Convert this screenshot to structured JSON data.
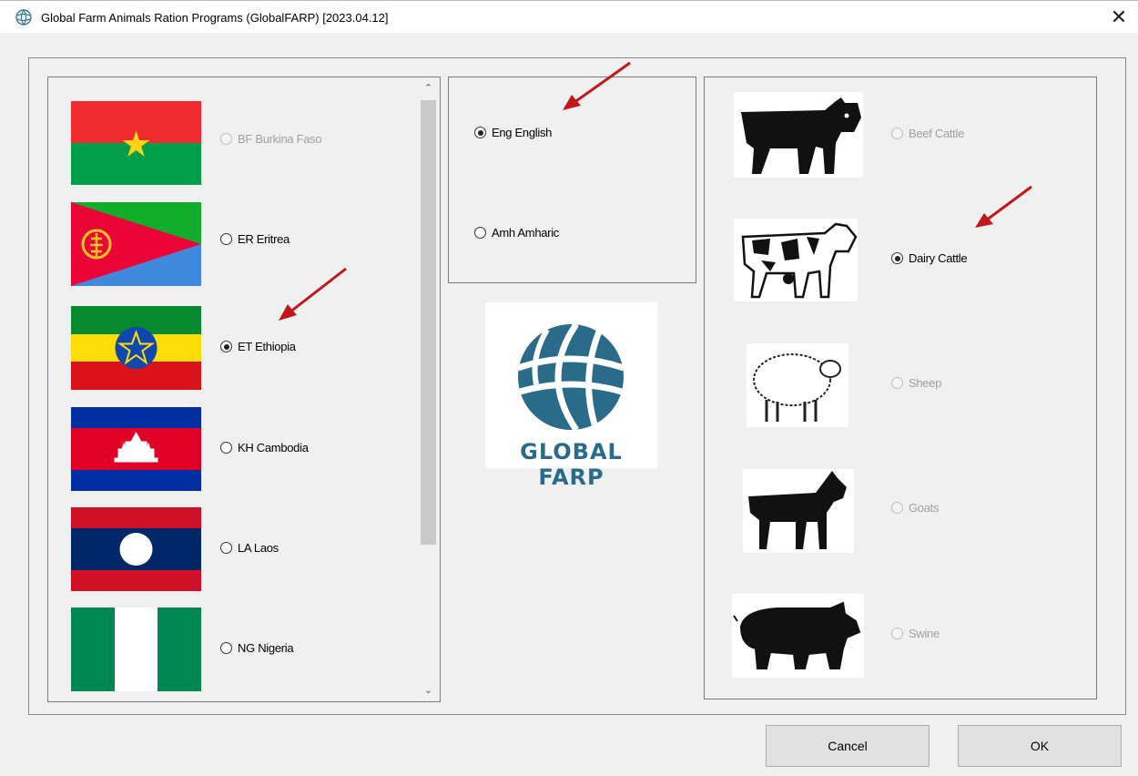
{
  "window": {
    "title": "Global Farm Animals Ration Programs (GlobalFARP) [2023.04.12]",
    "close_glyph": "✕",
    "icon": "globe-icon"
  },
  "countries": [
    {
      "code_label": "BF Burkina Faso",
      "checked": false,
      "disabled": true
    },
    {
      "code_label": "ER Eritrea",
      "checked": false,
      "disabled": false
    },
    {
      "code_label": "ET Ethiopia",
      "checked": true,
      "disabled": false
    },
    {
      "code_label": "KH Cambodia",
      "checked": false,
      "disabled": false
    },
    {
      "code_label": "LA Laos",
      "checked": false,
      "disabled": false
    },
    {
      "code_label": "NG Nigeria",
      "checked": false,
      "disabled": false
    }
  ],
  "languages": [
    {
      "label": "Eng English",
      "checked": true
    },
    {
      "label": "Amh Amharic",
      "checked": false
    }
  ],
  "logo": {
    "text": "GLOBAL FARP",
    "color": "#2a6b8a"
  },
  "animals": [
    {
      "label": "Beef Cattle",
      "checked": false,
      "disabled": true,
      "icon": "beef-cattle-icon"
    },
    {
      "label": "Dairy Cattle",
      "checked": true,
      "disabled": false,
      "icon": "dairy-cow-icon"
    },
    {
      "label": "Sheep",
      "checked": false,
      "disabled": true,
      "icon": "sheep-icon"
    },
    {
      "label": "Goats",
      "checked": false,
      "disabled": true,
      "icon": "goat-icon"
    },
    {
      "label": "Swine",
      "checked": false,
      "disabled": true,
      "icon": "pig-icon"
    }
  ],
  "buttons": {
    "cancel": "Cancel",
    "ok": "OK"
  },
  "scroll": {
    "up": "⌃",
    "down": "⌄"
  },
  "annotation_color": "#c0171b"
}
